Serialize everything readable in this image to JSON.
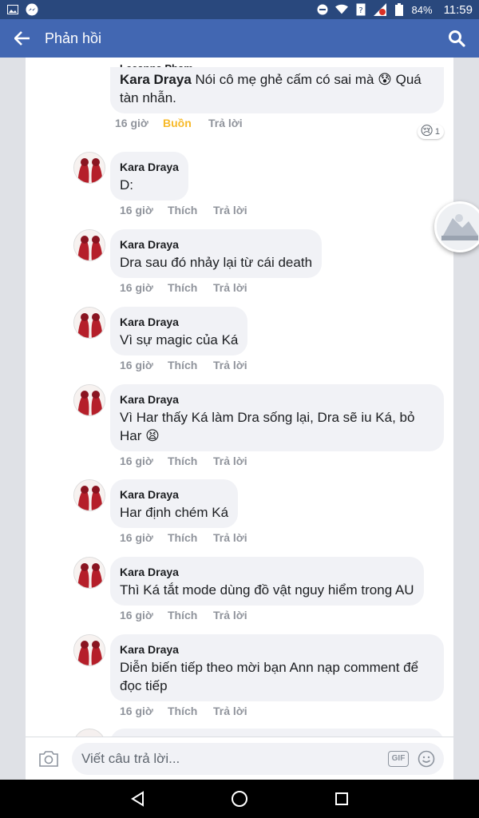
{
  "status_bar": {
    "battery": "84%",
    "time": "11:59"
  },
  "app_bar": {
    "title": "Phản hồi"
  },
  "prev_comment": {
    "author_partial": "Leeanna Phạm",
    "inline_author": "Kara Draya",
    "text": " Nói cô mẹ ghẻ cấm có sai mà 😰 Quá tàn nhẫn.",
    "time": "16 giờ",
    "reaction_label": "Buồn",
    "reply_label": "Trả lời",
    "reaction_count": "1",
    "reaction_emoji": "😢"
  },
  "comments": [
    {
      "author": "Kara Draya",
      "text": "D:",
      "time": "16 giờ",
      "like": "Thích",
      "reply": "Trả lời"
    },
    {
      "author": "Kara Draya",
      "text": "Dra sau đó nhảy lại từ cái death",
      "time": "16 giờ",
      "like": "Thích",
      "reply": "Trả lời"
    },
    {
      "author": "Kara Draya",
      "text": "Vì sự magic của Ká",
      "time": "16 giờ",
      "like": "Thích",
      "reply": "Trả lời"
    },
    {
      "author": "Kara Draya",
      "text": "Vì Har thấy Ká làm Dra sống lại, Dra sẽ iu Ká, bỏ Har 😫",
      "time": "16 giờ",
      "like": "Thích",
      "reply": "Trả lời"
    },
    {
      "author": "Kara Draya",
      "text": "Har định chém Ká",
      "time": "16 giờ",
      "like": "Thích",
      "reply": "Trả lời"
    },
    {
      "author": "Kara Draya",
      "text": "Thì Ká tắt mode dùng đồ vật nguy hiểm trong AU",
      "time": "16 giờ",
      "like": "Thích",
      "reply": "Trả lời"
    },
    {
      "author": "Kara Draya",
      "text": "Diễn biến tiếp theo mời bạn Ann nạp comment để đọc tiếp",
      "time": "16 giờ",
      "like": "Thích",
      "reply": "Trả lời"
    }
  ],
  "compose": {
    "placeholder": "Viết câu trả lời...",
    "gif_label": "GIF"
  },
  "icons": {
    "back": "arrow-left-icon",
    "search": "search-icon",
    "camera": "camera-icon",
    "emoji": "smiley-icon",
    "nav_back": "triangle-back-icon",
    "nav_home": "circle-home-icon",
    "nav_recents": "square-recents-icon"
  },
  "colors": {
    "app_bar": "#4267b2",
    "status_bar": "#29487d",
    "reaction_sad": "#f7b928",
    "bubble": "#f1f2f6"
  }
}
